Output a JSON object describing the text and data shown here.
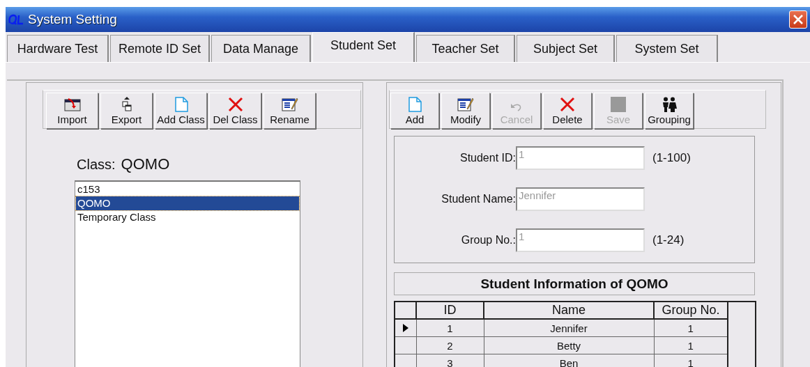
{
  "window": {
    "title": "System Setting"
  },
  "tabs": [
    {
      "label": "Hardware Test",
      "selected": false
    },
    {
      "label": "Remote ID Set",
      "selected": false
    },
    {
      "label": "Data Manage",
      "selected": false
    },
    {
      "label": "Student Set",
      "selected": true
    },
    {
      "label": "Teacher Set",
      "selected": false
    },
    {
      "label": "Subject Set",
      "selected": false
    },
    {
      "label": "System Set",
      "selected": false
    }
  ],
  "class_toolbar": [
    {
      "label": "Import",
      "kind": "import",
      "disabled": false
    },
    {
      "label": "Export",
      "kind": "export",
      "disabled": false
    },
    {
      "label": "Add Class",
      "kind": "add",
      "disabled": false
    },
    {
      "label": "Del Class",
      "kind": "delete",
      "disabled": false
    },
    {
      "label": "Rename",
      "kind": "edit",
      "disabled": false
    }
  ],
  "class_label": "Class:",
  "class_name": "QOMO",
  "class_list": [
    {
      "label": "c153",
      "selected": false
    },
    {
      "label": "QOMO",
      "selected": true
    },
    {
      "label": "Temporary Class",
      "selected": false
    }
  ],
  "student_toolbar": [
    {
      "label": "Add",
      "kind": "add",
      "disabled": false
    },
    {
      "label": "Modify",
      "kind": "edit",
      "disabled": false
    },
    {
      "label": "Cancel",
      "kind": "undo",
      "disabled": true
    },
    {
      "label": "Delete",
      "kind": "delete",
      "disabled": false
    },
    {
      "label": "Save",
      "kind": "save",
      "disabled": true
    },
    {
      "label": "Grouping",
      "kind": "group",
      "disabled": false
    }
  ],
  "form": [
    {
      "label": "Student ID:",
      "value": "1",
      "disabled": true,
      "range": "(1-100)"
    },
    {
      "label": "Student Name:",
      "value": "Jennifer",
      "disabled": true
    },
    {
      "label": "Group No.:",
      "value": "1",
      "disabled": true,
      "range": "(1-24)"
    }
  ],
  "table": {
    "title": "Student Information of QOMO",
    "columns": [
      "ID",
      "Name",
      "Group No."
    ],
    "rows": [
      {
        "cells": [
          "1",
          "Jennifer",
          "1"
        ],
        "selected": true
      },
      {
        "cells": [
          "2",
          "Betty",
          "1"
        ],
        "selected": false
      },
      {
        "cells": [
          "3",
          "Ben",
          "1"
        ],
        "selected": false
      }
    ]
  }
}
